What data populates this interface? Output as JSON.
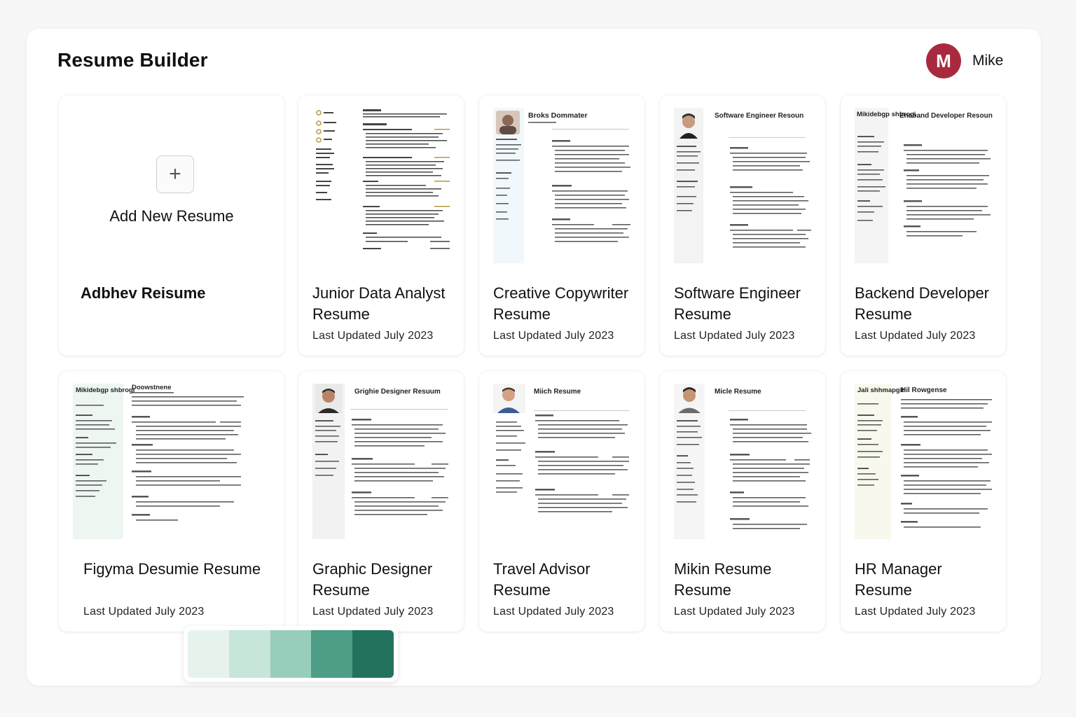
{
  "header": {
    "title": "Resume Builder"
  },
  "user": {
    "initial": "M",
    "name": "Mike"
  },
  "add_card": {
    "plus": "+",
    "label": "Add New Resume",
    "title": "Adbhev Reisume"
  },
  "resumes": [
    {
      "title": "Junior Data Analyst Resume",
      "updated": "Last Updated July 2023",
      "heading": "",
      "photo": false
    },
    {
      "title": "Creative Copywriter Resume",
      "updated": "Last Updated July 2023",
      "heading": "Broks Dommater",
      "photo": true
    },
    {
      "title": "Software Engineer Resume",
      "updated": "Last Updated July 2023",
      "heading": "Software Engineer Resoun",
      "photo": true
    },
    {
      "title": "Backend Developer Resume",
      "updated": "Last Updated July 2023",
      "heading": "Enaband Developer Resoun",
      "side_heading": "Mikidebgp shbrogi",
      "photo": false
    },
    {
      "title": "Figyma Desumie Resume",
      "updated": "Last Updated July 2023",
      "heading": "Doowstnene",
      "side_heading": "Mikidebgp shbrogi",
      "photo": false
    },
    {
      "title": "Graphic Designer Resume",
      "updated": "Last Updated July 2023",
      "heading": "Grighie Designer Resuum",
      "photo": true
    },
    {
      "title": "Travel Advisor Resume",
      "updated": "Last Updated July 2023",
      "heading": "Miich Resume",
      "photo": true
    },
    {
      "title": "Mikin Resume Resume",
      "updated": "Last Updated July 2023",
      "heading": "Micle Resume",
      "photo": true
    },
    {
      "title": "HR Manager Resume",
      "updated": "Last Updated July 2023",
      "heading": "Hil Rowgense",
      "side_heading": "Jali shhmapgit",
      "photo": false
    }
  ],
  "palette": {
    "swatches": [
      "#e5f3ec",
      "#c6e6d9",
      "#97cdbb",
      "#4e9d86",
      "#23725e"
    ]
  },
  "colors": {
    "avatar": "#a92a3f",
    "accent_gold": "#b59a3c"
  }
}
